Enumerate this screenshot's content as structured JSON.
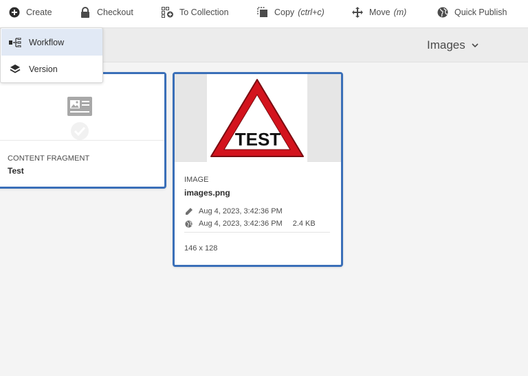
{
  "actionbar": {
    "create_label": "Create",
    "checkout_label": "Checkout",
    "collection_label": "To Collection",
    "copy_label": "Copy",
    "copy_shortcut": "(ctrl+c)",
    "move_label": "Move",
    "move_shortcut": "(m)",
    "publish_label": "Quick Publish"
  },
  "create_menu": {
    "items": [
      {
        "label": "Workflow",
        "icon": "workflow-icon",
        "highlighted": true
      },
      {
        "label": "Version",
        "icon": "layers-icon",
        "highlighted": false
      }
    ]
  },
  "header": {
    "view_label": "Images"
  },
  "cards": {
    "fragment": {
      "type_label": "CONTENT FRAGMENT",
      "title": "Test"
    },
    "image": {
      "thumbnail_text": "TEST",
      "type_label": "IMAGE",
      "title": "images.png",
      "modified": "Aug 4, 2023, 3:42:36 PM",
      "published": "Aug 4, 2023, 3:42:36 PM",
      "size": "2.4 KB",
      "dimensions": "146 x 128"
    }
  },
  "colors": {
    "selection_border": "#3a6fb8",
    "menu_highlight": "#e1e9f5",
    "warning_red": "#d3131d"
  }
}
